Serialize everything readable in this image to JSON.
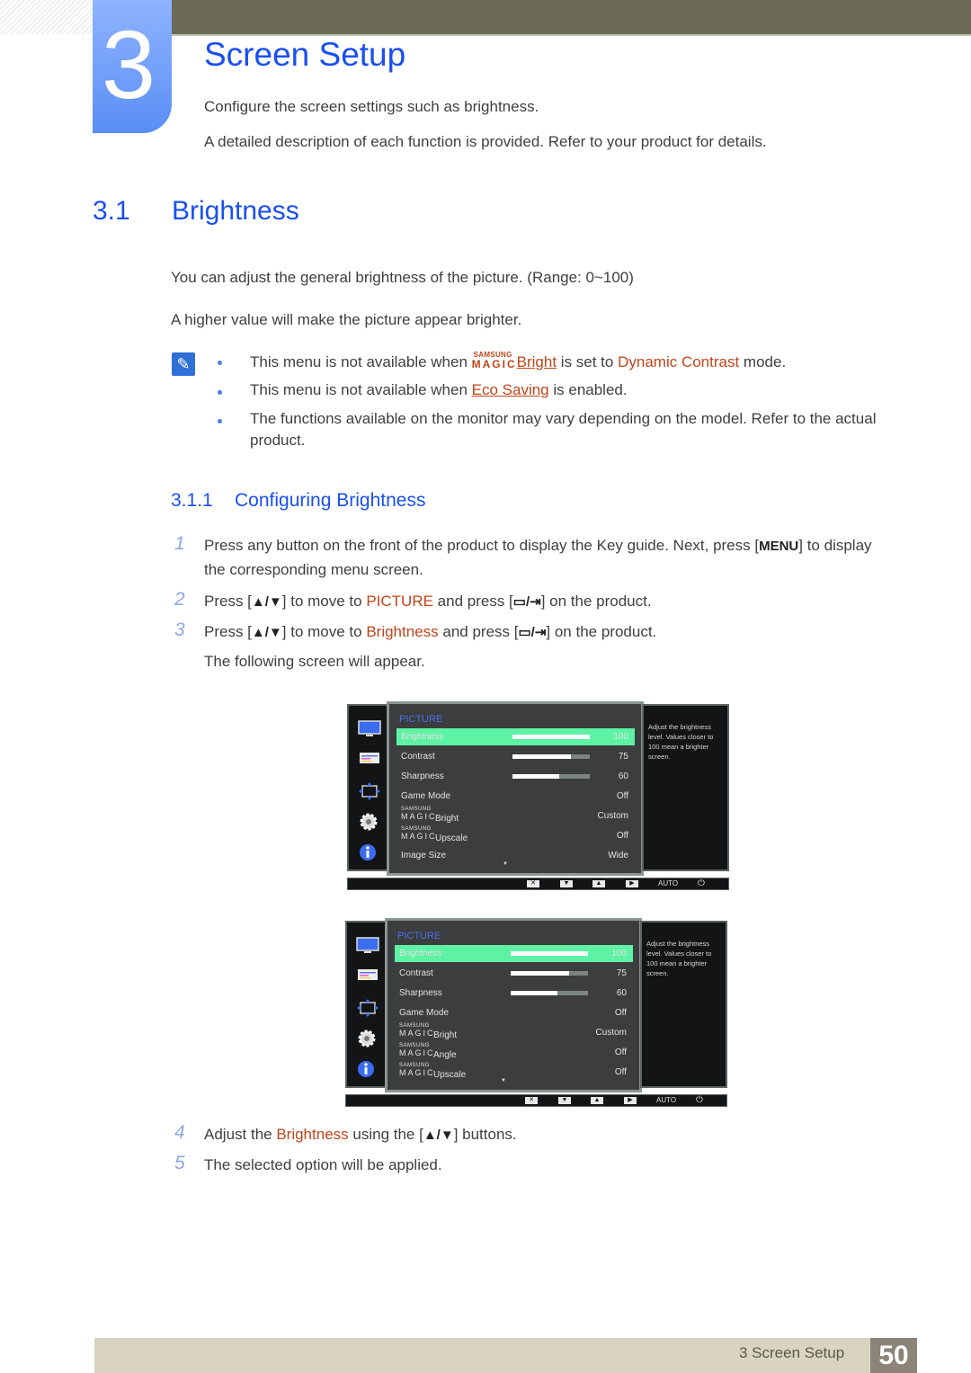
{
  "chapter": {
    "number": "3",
    "title": "Screen Setup",
    "intro": [
      "Configure the screen settings such as brightness.",
      "A detailed description of each function is provided. Refer to your product for details."
    ]
  },
  "section": {
    "number": "3.1",
    "title": "Brightness",
    "paragraphs": [
      "You can adjust the general brightness of the picture. (Range: 0~100)",
      "A higher value will make the picture appear brighter."
    ]
  },
  "notes": {
    "icon": "note-pencil-icon",
    "items": [
      {
        "pre": "This menu is not available when ",
        "magic_small": "SAMSUNG",
        "magic_big": "MAGIC",
        "link": "Bright",
        "mid": " is set to ",
        "highlight": "Dynamic Contrast",
        "post": " mode."
      },
      {
        "pre": "This menu is not available when ",
        "link": "Eco Saving",
        "post": " is enabled."
      },
      {
        "text": "The functions available on the monitor may vary depending on the model. Refer to the actual",
        "text2": "product."
      }
    ]
  },
  "subsection": {
    "number": "3.1.1",
    "title": "Configuring Brightness"
  },
  "steps": [
    {
      "num": "1",
      "line1_pre": "Press any button on the front of the product to display the Key guide. Next, press [",
      "key": "MENU",
      "line1_post": "] to display",
      "line2": "the corresponding menu screen."
    },
    {
      "num": "2",
      "pre": "Press [",
      "keys": "▲/▼",
      "mid": "] to move to ",
      "highlight": "PICTURE",
      "mid2": " and press [",
      "keys2": "▭/⇥",
      "post": "] on the product."
    },
    {
      "num": "3",
      "pre": "Press [",
      "keys": "▲/▼",
      "mid": "] to move to ",
      "highlight": "Brightness",
      "mid2": " and press [",
      "keys2": "▭/⇥",
      "post": "] on the product.",
      "line2": "The following screen will appear."
    },
    {
      "num": "4",
      "pre": "Adjust the ",
      "highlight": "Brightness",
      "mid": " using the [",
      "keys": "▲/▼",
      "post": "] buttons."
    },
    {
      "num": "5",
      "text": "The selected option will be applied."
    }
  ],
  "osd_screens": [
    {
      "title": "PICTURE",
      "help": "Adjust the brightness level. Values closer to 100 mean a brighter screen.",
      "rows": [
        {
          "label": "Brightness",
          "value": "100",
          "level": 100,
          "selected": true
        },
        {
          "label": "Contrast",
          "value": "75",
          "level": 75
        },
        {
          "label": "Sharpness",
          "value": "60",
          "level": 60
        },
        {
          "label": "Game Mode",
          "value": "Off"
        },
        {
          "magic": true,
          "magic_small": "SAMSUNG",
          "magic_big": "MAGIC",
          "label": "Bright",
          "value": "Custom"
        },
        {
          "magic": true,
          "magic_small": "SAMSUNG",
          "magic_big": "MAGIC",
          "label": "Upscale",
          "value": "Off"
        },
        {
          "label": "Image Size",
          "value": "Wide"
        }
      ],
      "bottom": {
        "auto": "AUTO"
      }
    },
    {
      "title": "PICTURE",
      "help": "Adjust the brightness level. Values closer to 100 mean a brighter screen.",
      "rows": [
        {
          "label": "Brightness",
          "value": "100",
          "level": 100,
          "selected": true
        },
        {
          "label": "Contrast",
          "value": "75",
          "level": 75
        },
        {
          "label": "Sharpness",
          "value": "60",
          "level": 60
        },
        {
          "label": "Game Mode",
          "value": "Off"
        },
        {
          "magic": true,
          "magic_small": "SAMSUNG",
          "magic_big": "MAGIC",
          "label": "Bright",
          "value": "Custom"
        },
        {
          "magic": true,
          "magic_small": "SAMSUNG",
          "magic_big": "MAGIC",
          "label": "Angle",
          "value": "Off"
        },
        {
          "magic": true,
          "magic_small": "SAMSUNG",
          "magic_big": "MAGIC",
          "label": "Upscale",
          "value": "Off"
        }
      ],
      "bottom": {
        "auto": "AUTO"
      }
    }
  ],
  "footer": {
    "label": "3 Screen Setup",
    "page": "50"
  },
  "colors": {
    "heading_blue": "#1a4ff0",
    "highlight_orange": "#c0451a",
    "osd_selected": "#5ef2a4",
    "top_bar": "#6b6b57",
    "footer_bar": "#d8d4c0",
    "footer_page": "#8c8478"
  }
}
